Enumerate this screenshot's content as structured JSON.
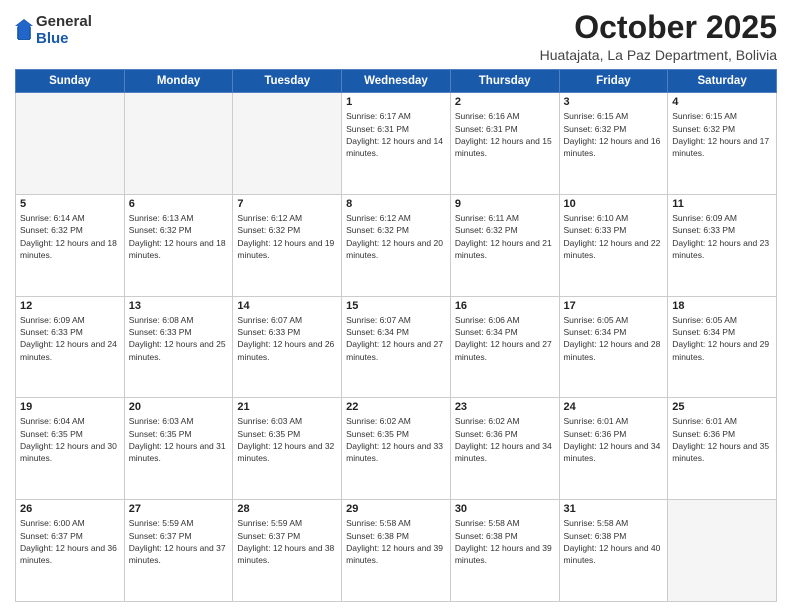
{
  "logo": {
    "general": "General",
    "blue": "Blue"
  },
  "header": {
    "month": "October 2025",
    "location": "Huatajata, La Paz Department, Bolivia"
  },
  "days_of_week": [
    "Sunday",
    "Monday",
    "Tuesday",
    "Wednesday",
    "Thursday",
    "Friday",
    "Saturday"
  ],
  "weeks": [
    [
      {
        "day": "",
        "empty": true
      },
      {
        "day": "",
        "empty": true
      },
      {
        "day": "",
        "empty": true
      },
      {
        "day": "1",
        "sunrise": "6:17 AM",
        "sunset": "6:31 PM",
        "daylight": "12 hours and 14 minutes."
      },
      {
        "day": "2",
        "sunrise": "6:16 AM",
        "sunset": "6:31 PM",
        "daylight": "12 hours and 15 minutes."
      },
      {
        "day": "3",
        "sunrise": "6:15 AM",
        "sunset": "6:32 PM",
        "daylight": "12 hours and 16 minutes."
      },
      {
        "day": "4",
        "sunrise": "6:15 AM",
        "sunset": "6:32 PM",
        "daylight": "12 hours and 17 minutes."
      }
    ],
    [
      {
        "day": "5",
        "sunrise": "6:14 AM",
        "sunset": "6:32 PM",
        "daylight": "12 hours and 18 minutes."
      },
      {
        "day": "6",
        "sunrise": "6:13 AM",
        "sunset": "6:32 PM",
        "daylight": "12 hours and 18 minutes."
      },
      {
        "day": "7",
        "sunrise": "6:12 AM",
        "sunset": "6:32 PM",
        "daylight": "12 hours and 19 minutes."
      },
      {
        "day": "8",
        "sunrise": "6:12 AM",
        "sunset": "6:32 PM",
        "daylight": "12 hours and 20 minutes."
      },
      {
        "day": "9",
        "sunrise": "6:11 AM",
        "sunset": "6:32 PM",
        "daylight": "12 hours and 21 minutes."
      },
      {
        "day": "10",
        "sunrise": "6:10 AM",
        "sunset": "6:33 PM",
        "daylight": "12 hours and 22 minutes."
      },
      {
        "day": "11",
        "sunrise": "6:09 AM",
        "sunset": "6:33 PM",
        "daylight": "12 hours and 23 minutes."
      }
    ],
    [
      {
        "day": "12",
        "sunrise": "6:09 AM",
        "sunset": "6:33 PM",
        "daylight": "12 hours and 24 minutes."
      },
      {
        "day": "13",
        "sunrise": "6:08 AM",
        "sunset": "6:33 PM",
        "daylight": "12 hours and 25 minutes."
      },
      {
        "day": "14",
        "sunrise": "6:07 AM",
        "sunset": "6:33 PM",
        "daylight": "12 hours and 26 minutes."
      },
      {
        "day": "15",
        "sunrise": "6:07 AM",
        "sunset": "6:34 PM",
        "daylight": "12 hours and 27 minutes."
      },
      {
        "day": "16",
        "sunrise": "6:06 AM",
        "sunset": "6:34 PM",
        "daylight": "12 hours and 27 minutes."
      },
      {
        "day": "17",
        "sunrise": "6:05 AM",
        "sunset": "6:34 PM",
        "daylight": "12 hours and 28 minutes."
      },
      {
        "day": "18",
        "sunrise": "6:05 AM",
        "sunset": "6:34 PM",
        "daylight": "12 hours and 29 minutes."
      }
    ],
    [
      {
        "day": "19",
        "sunrise": "6:04 AM",
        "sunset": "6:35 PM",
        "daylight": "12 hours and 30 minutes."
      },
      {
        "day": "20",
        "sunrise": "6:03 AM",
        "sunset": "6:35 PM",
        "daylight": "12 hours and 31 minutes."
      },
      {
        "day": "21",
        "sunrise": "6:03 AM",
        "sunset": "6:35 PM",
        "daylight": "12 hours and 32 minutes."
      },
      {
        "day": "22",
        "sunrise": "6:02 AM",
        "sunset": "6:35 PM",
        "daylight": "12 hours and 33 minutes."
      },
      {
        "day": "23",
        "sunrise": "6:02 AM",
        "sunset": "6:36 PM",
        "daylight": "12 hours and 34 minutes."
      },
      {
        "day": "24",
        "sunrise": "6:01 AM",
        "sunset": "6:36 PM",
        "daylight": "12 hours and 34 minutes."
      },
      {
        "day": "25",
        "sunrise": "6:01 AM",
        "sunset": "6:36 PM",
        "daylight": "12 hours and 35 minutes."
      }
    ],
    [
      {
        "day": "26",
        "sunrise": "6:00 AM",
        "sunset": "6:37 PM",
        "daylight": "12 hours and 36 minutes."
      },
      {
        "day": "27",
        "sunrise": "5:59 AM",
        "sunset": "6:37 PM",
        "daylight": "12 hours and 37 minutes."
      },
      {
        "day": "28",
        "sunrise": "5:59 AM",
        "sunset": "6:37 PM",
        "daylight": "12 hours and 38 minutes."
      },
      {
        "day": "29",
        "sunrise": "5:58 AM",
        "sunset": "6:38 PM",
        "daylight": "12 hours and 39 minutes."
      },
      {
        "day": "30",
        "sunrise": "5:58 AM",
        "sunset": "6:38 PM",
        "daylight": "12 hours and 39 minutes."
      },
      {
        "day": "31",
        "sunrise": "5:58 AM",
        "sunset": "6:38 PM",
        "daylight": "12 hours and 40 minutes."
      },
      {
        "day": "",
        "empty": true
      }
    ]
  ]
}
